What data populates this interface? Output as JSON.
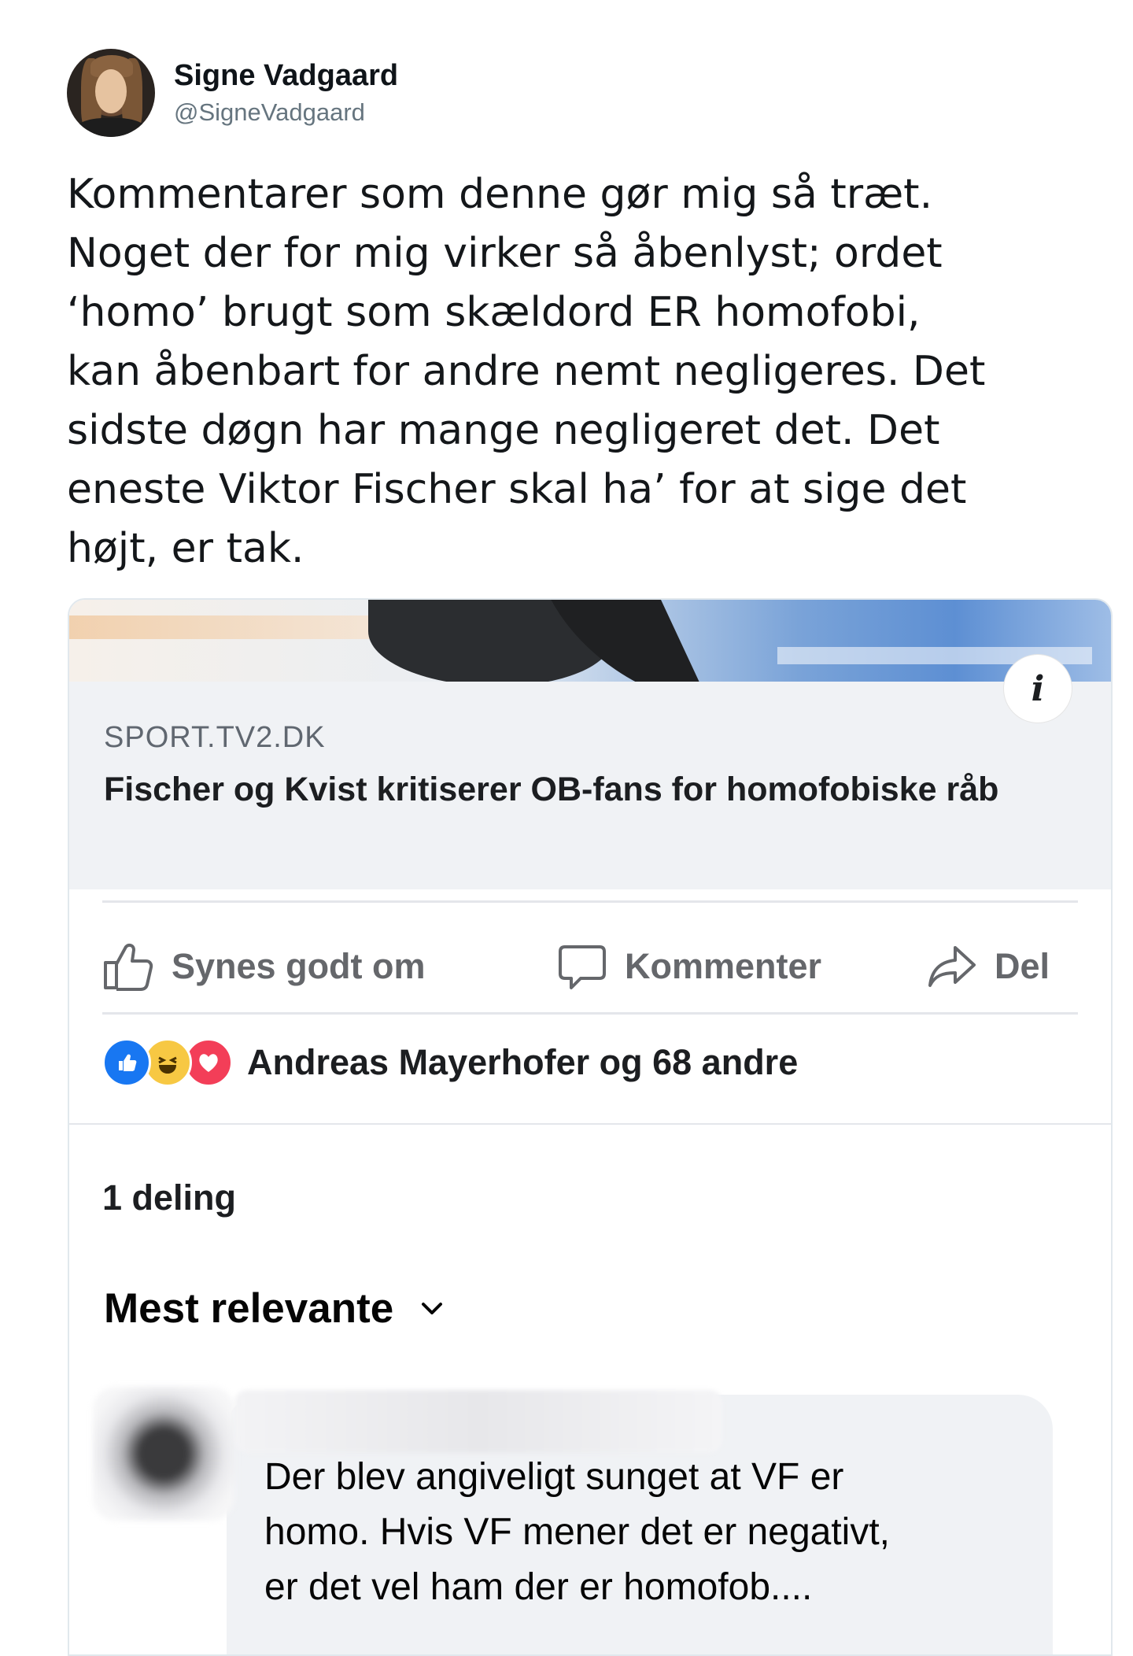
{
  "tweet": {
    "author_name": "Signe Vadgaard",
    "author_handle": "@SigneVadgaard",
    "text_lines": [
      "Kommentarer som denne gør mig så træt.",
      "Noget der for mig virker så åbenlyst; ordet",
      "‘homo’ brugt som skældord ER homofobi,",
      "kan åbenbart for andre nemt negligeres. Det",
      "sidste døgn har mange negligeret det. Det",
      "eneste Viktor Fischer skal ha’ for at sige det",
      "højt, er tak."
    ]
  },
  "embedded_post": {
    "link_domain": "SPORT.TV2.DK",
    "link_title": "Fischer og Kvist kritiserer OB-fans for homofobiske råb",
    "actions": {
      "like": "Synes godt om",
      "comment": "Kommenter",
      "share": "Del"
    },
    "reactions_text": "Andreas Mayerhofer og 68 andre",
    "shares_text": "1 deling",
    "sort_label": "Mest relevante",
    "comment_lines": [
      "Der blev angiveligt sunget at VF er",
      "homo. Hvis VF mener det er negativt,",
      "er det vel ham der er homofob...."
    ]
  },
  "colors": {
    "facebook_blue": "#1877f2",
    "haha_yellow": "#f7c843",
    "love_red": "#f33e58",
    "muted_gray": "#65676b"
  }
}
